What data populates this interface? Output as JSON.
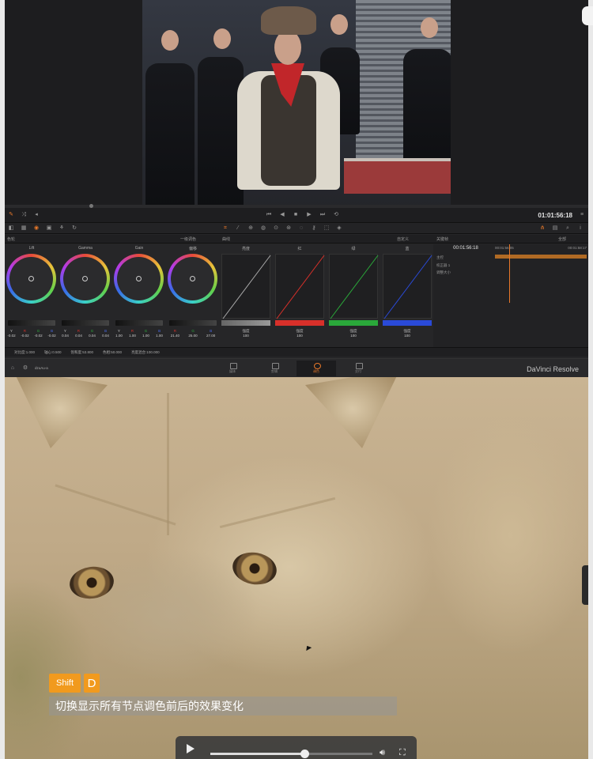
{
  "viewer": {
    "title": ""
  },
  "transport": {
    "timecode": "01:01:56:18"
  },
  "headers": {
    "wheels": "色轮",
    "wheels_mode": "一级调色",
    "curves": "曲线",
    "curves_mode": "自定义",
    "keyframes": "关键帧",
    "keyframes_mode": "全部"
  },
  "wheels": [
    {
      "title": "Lift",
      "labels": [
        "Y",
        "R",
        "G",
        "B"
      ],
      "values": [
        "-0.02",
        "-0.02",
        "-0.02",
        "-0.02"
      ]
    },
    {
      "title": "Gamma",
      "labels": [
        "Y",
        "R",
        "G",
        "B"
      ],
      "values": [
        "0.04",
        "0.04",
        "0.04",
        "0.04"
      ]
    },
    {
      "title": "Gain",
      "labels": [
        "Y",
        "R",
        "G",
        "B"
      ],
      "values": [
        "1.00",
        "1.00",
        "1.00",
        "1.00"
      ]
    },
    {
      "title": "偏移",
      "labels": [
        "R",
        "G",
        "B"
      ],
      "values": [
        "21.40",
        "25.00",
        "27.00"
      ]
    }
  ],
  "curves": [
    {
      "title": "亮度",
      "label": "强度",
      "value": "100",
      "color": "#888888"
    },
    {
      "title": "红",
      "label": "强度",
      "value": "100",
      "color": "#d8302a"
    },
    {
      "title": "绿",
      "label": "强度",
      "value": "100",
      "color": "#2aa83a"
    },
    {
      "title": "蓝",
      "label": "强度",
      "value": "100",
      "color": "#2a4ad8"
    }
  ],
  "keyframes": {
    "time": "00:01:56:18",
    "ruler_start": "00:01:56:05",
    "ruler_end": "00:01:58:17",
    "tracks": [
      "主控",
      "校正器 1",
      "调整大小"
    ]
  },
  "params": {
    "contrast": "对比度:1.000",
    "pivot": "轴心:0.500",
    "saturation": "饱和度:53.800",
    "hue": "色相:50.000",
    "lum_mix": "亮度混合:100.000"
  },
  "pages": {
    "user": "dzuAu-a",
    "tabs": [
      "媒体",
      "剪辑",
      "调色",
      "交付"
    ],
    "active": "调色",
    "brand": "DaVinci Resolve"
  },
  "overlay": {
    "key_shift": "Shift",
    "key_d": "D",
    "caption": "切换显示所有节点调色前后的效果变化"
  },
  "player": {
    "progress": 0.58
  },
  "colors": {
    "accent": "#e8782a",
    "shortcut_key": "#f19a1e"
  }
}
